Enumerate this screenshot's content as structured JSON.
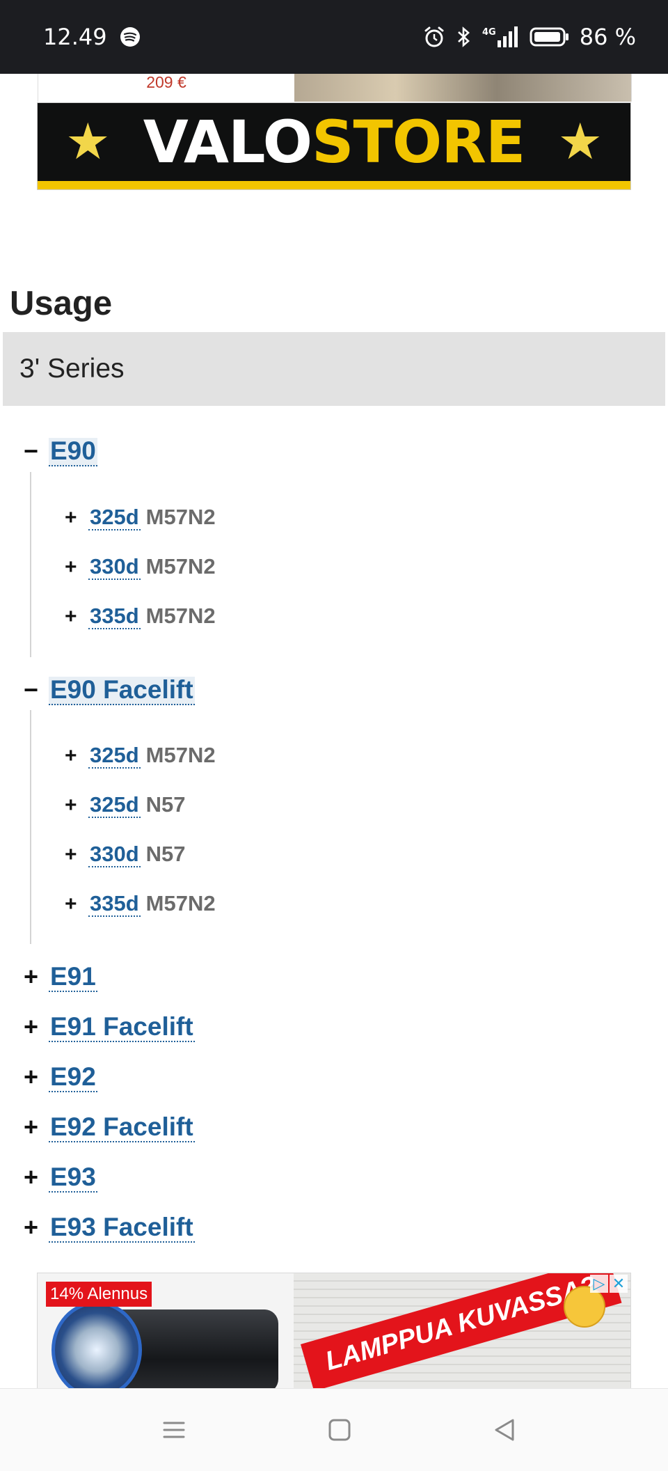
{
  "status_bar": {
    "time": "12.49",
    "network": "4G",
    "battery": "86 %"
  },
  "top_ad": {
    "price": "209 €",
    "brand_part1": "VALO",
    "brand_part2": "STORE"
  },
  "usage": {
    "heading": "Usage",
    "series_label": "3' Series"
  },
  "tree": {
    "e90": {
      "toggle": "−",
      "label": "E90",
      "children": [
        {
          "toggle": "+",
          "label": "325d",
          "engine": "M57N2"
        },
        {
          "toggle": "+",
          "label": "330d",
          "engine": "M57N2"
        },
        {
          "toggle": "+",
          "label": "335d",
          "engine": "M57N2"
        }
      ]
    },
    "e90_facelift": {
      "toggle": "−",
      "label": "E90 Facelift",
      "children": [
        {
          "toggle": "+",
          "label": "325d",
          "engine": "M57N2"
        },
        {
          "toggle": "+",
          "label": "325d",
          "engine": "N57"
        },
        {
          "toggle": "+",
          "label": "330d",
          "engine": "N57"
        },
        {
          "toggle": "+",
          "label": "335d",
          "engine": "M57N2"
        }
      ]
    },
    "collapsed": [
      {
        "toggle": "+",
        "label": "E91"
      },
      {
        "toggle": "+",
        "label": "E91 Facelift"
      },
      {
        "toggle": "+",
        "label": "E92"
      },
      {
        "toggle": "+",
        "label": "E92 Facelift"
      },
      {
        "toggle": "+",
        "label": "E93"
      },
      {
        "toggle": "+",
        "label": "E93 Facelift"
      }
    ]
  },
  "bottom_ad": {
    "badge": "14% Alennus",
    "banner_text": "LAMPPUA KUVASSA?"
  },
  "colors": {
    "link": "#1f5f98",
    "brand_yellow": "#f2c500",
    "ad_red": "#e3141b"
  }
}
